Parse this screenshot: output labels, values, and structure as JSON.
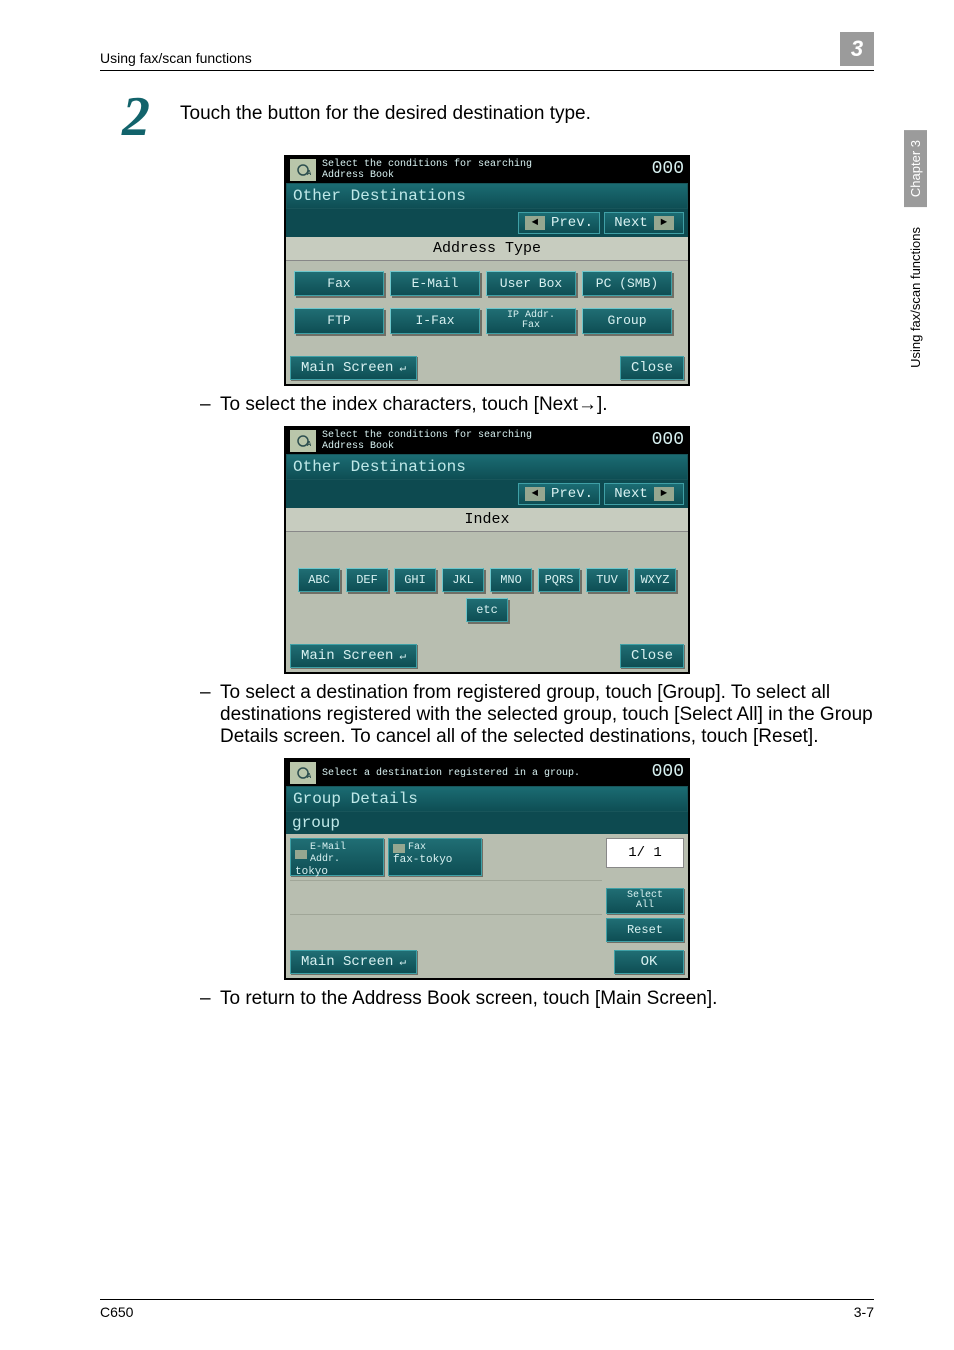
{
  "header": {
    "left": "Using fax/scan functions",
    "chapter_number": "3"
  },
  "side": {
    "chapter": "Chapter 3",
    "section": "Using fax/scan functions"
  },
  "step": {
    "number": "2",
    "text": "Touch the button for the desired destination type."
  },
  "bullets": {
    "b1": "To select the index characters, touch [Next→].",
    "b2": "To select a destination from registered group, touch [Group]. To select all destinations registered with the selected group, touch [Select All] in the Group Details screen. To cancel all of the selected destinations, touch [Reset].",
    "b3": "To return to the Address Book screen, touch [Main Screen]."
  },
  "panel1": {
    "hint_line1": "Select the conditions for searching",
    "hint_line2": "Address Book",
    "counter": "000",
    "title": "Other Destinations",
    "nav_prev": "Prev.",
    "nav_next": "Next",
    "section": "Address Type",
    "buttons_row1": [
      "Fax",
      "E-Mail",
      "User Box",
      "PC (SMB)"
    ],
    "buttons_row2": [
      "FTP",
      "I-Fax"
    ],
    "ip_line1": "IP Addr.",
    "ip_line2": "Fax",
    "group_label": "Group",
    "main": "Main Screen",
    "close": "Close"
  },
  "panel2": {
    "hint_line1": "Select the conditions for searching",
    "hint_line2": "Address Book",
    "counter": "000",
    "title": "Other Destinations",
    "nav_prev": "Prev.",
    "nav_next": "Next",
    "section": "Index",
    "buttons": [
      "ABC",
      "DEF",
      "GHI",
      "JKL",
      "MNO",
      "PQRS",
      "TUV",
      "WXYZ",
      "etc"
    ],
    "main": "Main Screen",
    "close": "Close"
  },
  "panel3": {
    "hint": "Select a destination registered in a group.",
    "counter": "000",
    "title": "Group Details",
    "group_name": "group",
    "dest1": {
      "type_line1": "E-Mail",
      "type_line2": "Addr.",
      "name": "tokyo"
    },
    "dest2": {
      "type": "Fax",
      "name": "fax-tokyo"
    },
    "page": "1/ 1",
    "select_all_l1": "Select",
    "select_all_l2": "All",
    "reset": "Reset",
    "main": "Main Screen",
    "ok": "OK"
  },
  "footer": {
    "left": "C650",
    "right": "3-7"
  }
}
